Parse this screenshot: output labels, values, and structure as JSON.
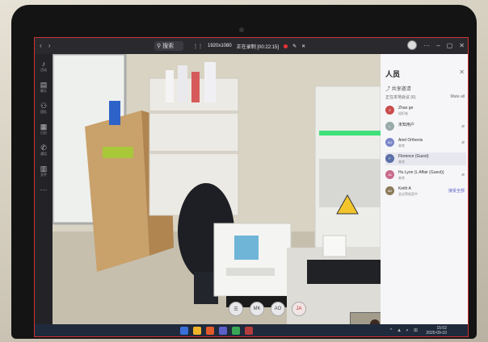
{
  "titlebar": {
    "search_label": "搜索",
    "meeting_size": "1920x1080",
    "meeting_time": "正在录制 [00:22:15]"
  },
  "rail": {
    "items": [
      {
        "icon": "bell-icon",
        "label": "活动"
      },
      {
        "icon": "chat-icon",
        "label": "聊天"
      },
      {
        "icon": "teams-icon",
        "label": "团队"
      },
      {
        "icon": "calendar-icon",
        "label": "日历"
      },
      {
        "icon": "phone-icon",
        "label": "通话"
      },
      {
        "icon": "files-icon",
        "label": "文件"
      }
    ]
  },
  "panel": {
    "title": "人员",
    "share_invite": "共享邀请",
    "section": "正在本地会议 (6)",
    "mute_all": "Mute all",
    "people": [
      {
        "initials": "Z",
        "name": "Zhao ge",
        "sub": "组织者",
        "color": "#c94c4c"
      },
      {
        "initials": "L",
        "name": "未知用户",
        "sub": "",
        "color": "#9aa"
      },
      {
        "initials": "AO",
        "name": "Ariel Orthenis",
        "sub": "来宾",
        "color": "#7a86c9"
      },
      {
        "initials": "F",
        "name": "Florence (Guest)",
        "sub": "来宾",
        "color": "#5b6fa8"
      },
      {
        "initials": "JA",
        "name": "Hu Lyon (L Affair (Guest))",
        "sub": "来宾",
        "color": "#c96b8a"
      },
      {
        "initials": "AD",
        "name": "Keith A",
        "sub": "会议等候室中",
        "color": "#8b7a5a",
        "action": "接受全部"
      }
    ]
  },
  "controls": {
    "buttons": [
      "☰",
      "MK",
      "AO",
      "JA"
    ]
  },
  "taskbar": {
    "time": "15:02",
    "date": "2020-09-10"
  }
}
